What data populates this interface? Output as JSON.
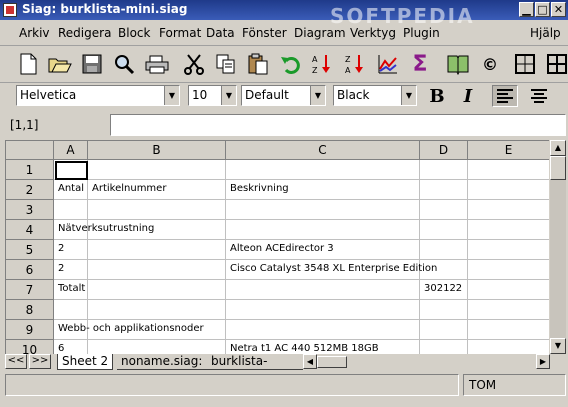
{
  "window": {
    "title": "Siag: burklista-mini.siag",
    "watermark": "SOFTPEDIA"
  },
  "menu": {
    "items": [
      "Arkiv",
      "Redigera",
      "Block",
      "Format",
      "Data",
      "Fönster",
      "Diagram",
      "Verktyg",
      "Plugin"
    ],
    "help": "Hjälp"
  },
  "toolbar": {
    "icons": [
      "new-file-icon",
      "open-folder-icon",
      "save-disk-icon",
      "search-icon",
      "print-icon",
      "cut-scissors-icon",
      "copy-icon",
      "paste-icon",
      "undo-icon",
      "sort-ascending-icon",
      "sort-descending-icon",
      "chart-icon",
      "sum-sigma-icon",
      "help-book-icon",
      "copyright-icon",
      "borders-icon",
      "grid-icon"
    ]
  },
  "format": {
    "font": "Helvetica",
    "size": "10",
    "style": "Default",
    "color": "Black",
    "bold": "B",
    "italic": "I"
  },
  "refbar": {
    "cell": "[1,1]",
    "formula": ""
  },
  "grid": {
    "columns": [
      "A",
      "B",
      "C",
      "D",
      "E"
    ],
    "rows": [
      "1",
      "2",
      "3",
      "4",
      "5",
      "6",
      "7",
      "8",
      "9",
      "10"
    ],
    "cells": [
      {
        "r": 2,
        "c": "A",
        "v": "Antal"
      },
      {
        "r": 2,
        "c": "B",
        "v": "Artikelnummer"
      },
      {
        "r": 2,
        "c": "C",
        "v": "Beskrivning"
      },
      {
        "r": 4,
        "c": "A",
        "v": "Nätverksutrustning"
      },
      {
        "r": 5,
        "c": "A",
        "v": "2"
      },
      {
        "r": 5,
        "c": "C",
        "v": "Alteon ACEdirector 3"
      },
      {
        "r": 6,
        "c": "A",
        "v": "2"
      },
      {
        "r": 6,
        "c": "C",
        "v": "Cisco Catalyst 3548 XL Enterprise Edition"
      },
      {
        "r": 7,
        "c": "A",
        "v": "Totalt"
      },
      {
        "r": 7,
        "c": "D",
        "v": "302122"
      },
      {
        "r": 9,
        "c": "A",
        "v": "Webb- och applikationsnoder"
      },
      {
        "r": 10,
        "c": "A",
        "v": "6"
      },
      {
        "r": 10,
        "c": "C",
        "v": "Netra t1 AC 440 512MB 18GB"
      }
    ]
  },
  "sheets": {
    "prev": "<<",
    "next": ">>",
    "tabs": [
      "Sheet 2",
      "noname.siag:",
      "burklista-sun.siag"
    ]
  },
  "status": {
    "message": "",
    "user": "TOM"
  }
}
